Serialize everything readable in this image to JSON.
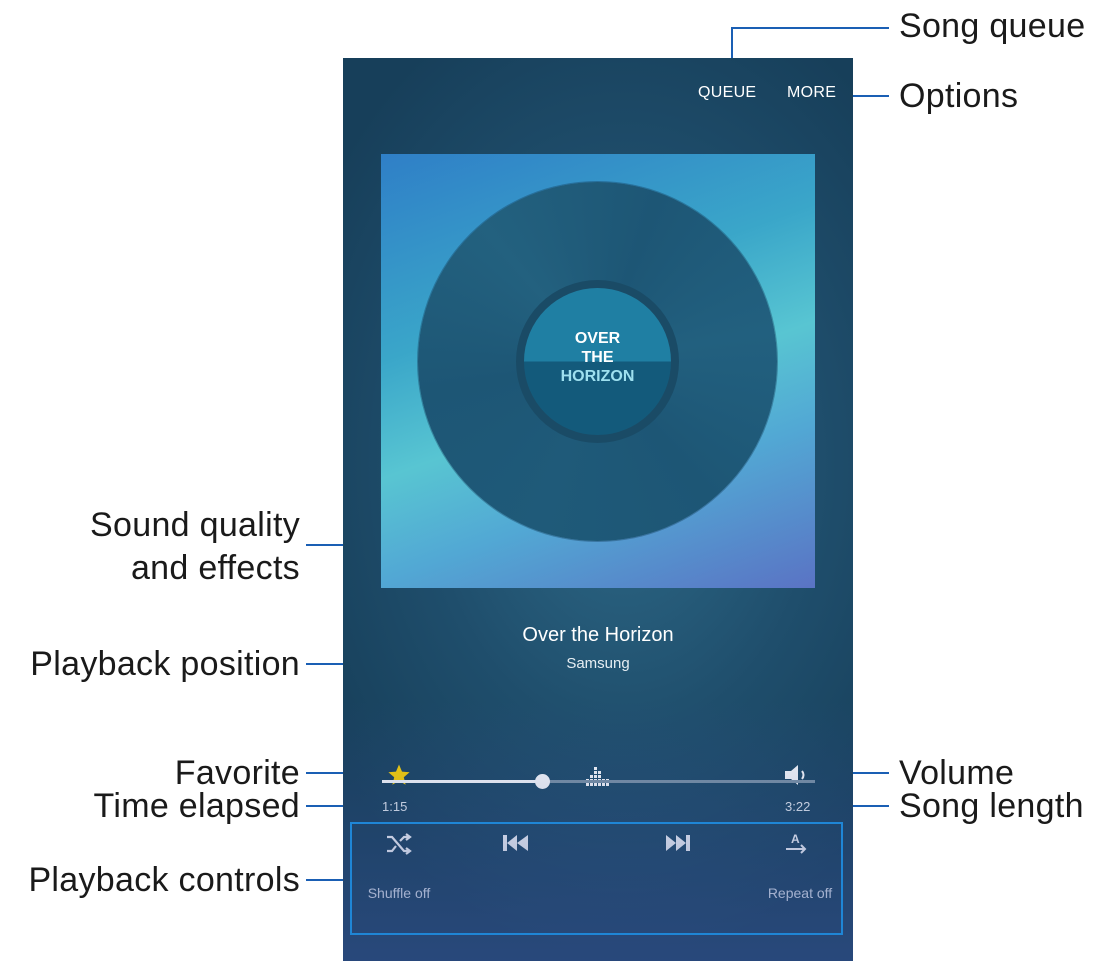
{
  "callouts": {
    "song_queue": "Song queue",
    "options": "Options",
    "sound_quality_line1": "Sound quality",
    "sound_quality_line2": "and effects",
    "playback_position": "Playback position",
    "favorite": "Favorite",
    "volume": "Volume",
    "time_elapsed": "Time elapsed",
    "song_length": "Song length",
    "playback_controls": "Playback controls"
  },
  "header": {
    "queue_label": "QUEUE",
    "more_label": "MORE"
  },
  "album_art": {
    "line1": "OVER",
    "line2": "THE",
    "line3": "HORIZON"
  },
  "track": {
    "title": "Over the Horizon",
    "artist": "Samsung",
    "elapsed": "1:15",
    "length": "3:22",
    "progress_fraction": 0.37
  },
  "icons": {
    "favorite": "star-icon",
    "sound_effects": "equalizer-icon",
    "volume": "speaker-icon",
    "shuffle": "shuffle-icon",
    "previous": "skip-previous-icon",
    "pause": "pause-icon",
    "next": "skip-next-icon",
    "repeat": "repeat-icon"
  },
  "controls": {
    "shuffle_label": "Shuffle off",
    "repeat_label": "Repeat off"
  },
  "colors": {
    "favorite_star": "#ffd400",
    "leader_line": "#1a5fb4",
    "controls_highlight": "#1f86d6"
  }
}
